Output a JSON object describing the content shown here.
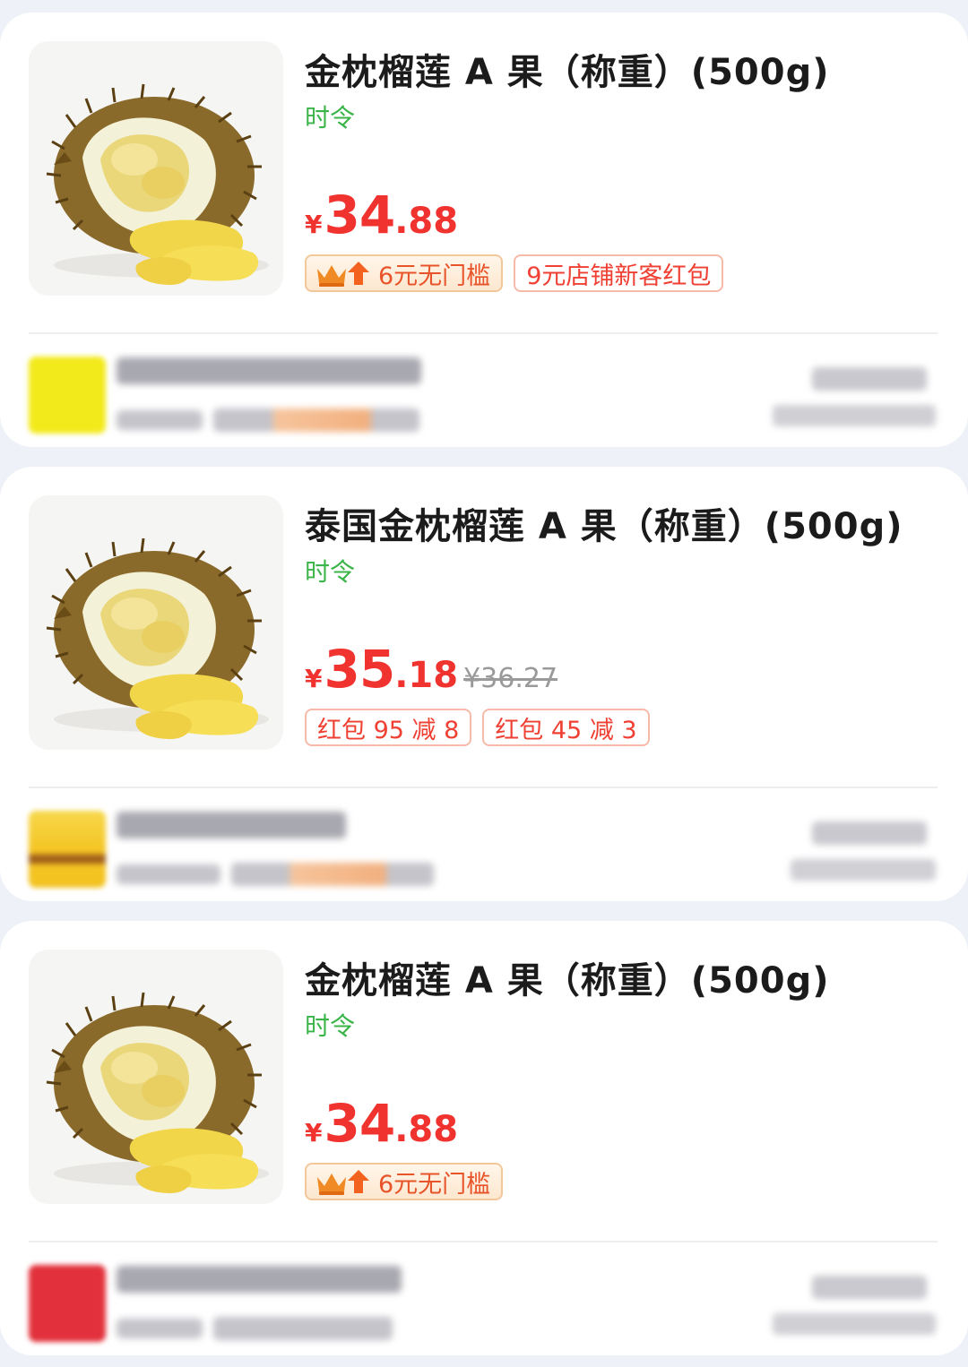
{
  "products": [
    {
      "title": "金枕榴莲 A 果（称重）(500g)",
      "season_tag": "时令",
      "price": {
        "currency": "¥",
        "integer": "34",
        "decimal": ".88",
        "original": ""
      },
      "member_tag": "6元无门槛",
      "coupons": [
        "9元店铺新客红包"
      ],
      "store_logo_color": "#f2ea1a"
    },
    {
      "title": "泰国金枕榴莲 A 果（称重）(500g)",
      "season_tag": "时令",
      "price": {
        "currency": "¥",
        "integer": "35",
        "decimal": ".18",
        "original": "¥36.27"
      },
      "member_tag": "",
      "coupons": [
        "红包 95 减 8",
        "红包 45 减 3"
      ],
      "store_logo_color": "#f3c321"
    },
    {
      "title": "金枕榴莲 A 果（称重）(500g)",
      "season_tag": "时令",
      "price": {
        "currency": "¥",
        "integer": "34",
        "decimal": ".88",
        "original": ""
      },
      "member_tag": "6元无门槛",
      "coupons": [],
      "store_logo_color": "#e2313c"
    }
  ],
  "colors": {
    "price": "#f0332f",
    "season": "#3bb549",
    "coupon_border": "#f7b9a8",
    "background": "#eef2f8"
  },
  "icons": {
    "member": "crown-up-arrow-icon",
    "product_image": "durian-image"
  }
}
